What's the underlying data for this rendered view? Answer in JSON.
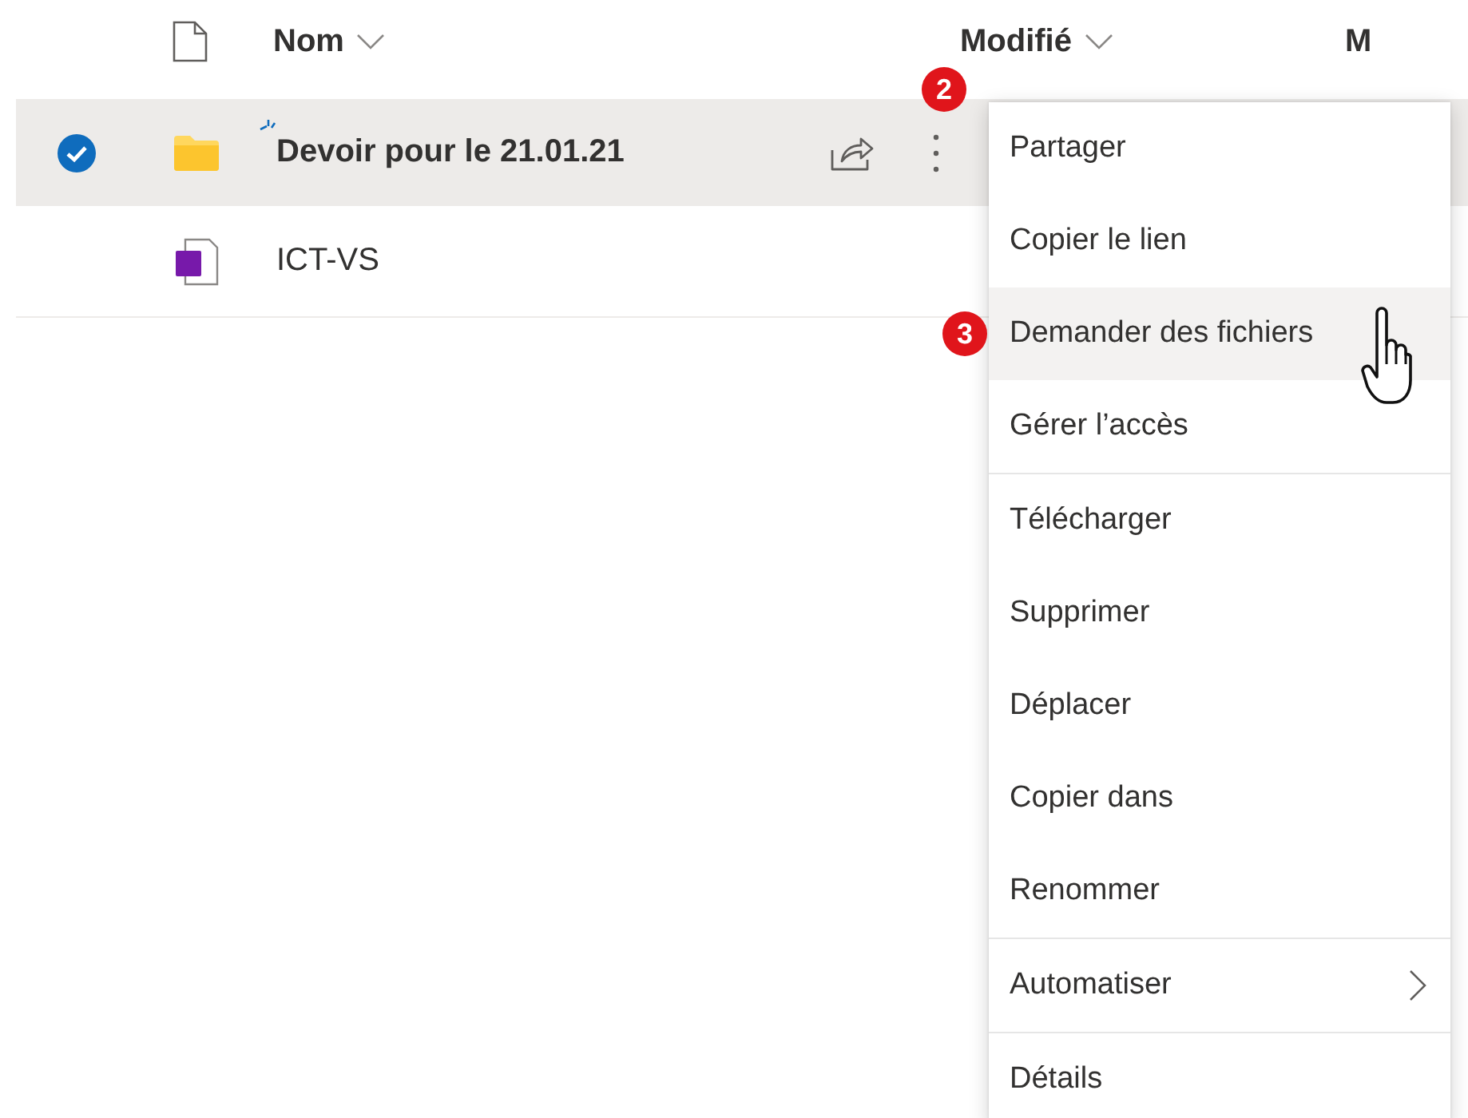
{
  "header": {
    "name_column": "Nom",
    "modified_column": "Modifié",
    "column_3": "M"
  },
  "rows": [
    {
      "name": "Devoir pour le 21.01.21",
      "kind": "folder",
      "selected": true,
      "recent": true,
      "step_badge": "2"
    },
    {
      "name": "ICT-VS",
      "kind": "onenote",
      "selected": false,
      "recent": false
    }
  ],
  "context_menu": {
    "groups": [
      [
        {
          "label": "Partager",
          "highlighted": false,
          "submenu": false
        },
        {
          "label": "Copier le lien",
          "highlighted": false,
          "submenu": false
        },
        {
          "label": "Demander des fichiers",
          "highlighted": true,
          "submenu": false,
          "step_badge": "3"
        },
        {
          "label": "Gérer l’accès",
          "highlighted": false,
          "submenu": false
        }
      ],
      [
        {
          "label": "Télécharger",
          "highlighted": false,
          "submenu": false
        },
        {
          "label": "Supprimer",
          "highlighted": false,
          "submenu": false
        },
        {
          "label": "Déplacer",
          "highlighted": false,
          "submenu": false
        },
        {
          "label": "Copier dans",
          "highlighted": false,
          "submenu": false
        },
        {
          "label": "Renommer",
          "highlighted": false,
          "submenu": false
        }
      ],
      [
        {
          "label": "Automatiser",
          "highlighted": false,
          "submenu": true
        }
      ],
      [
        {
          "label": "Détails",
          "highlighted": false,
          "submenu": false
        }
      ]
    ]
  }
}
